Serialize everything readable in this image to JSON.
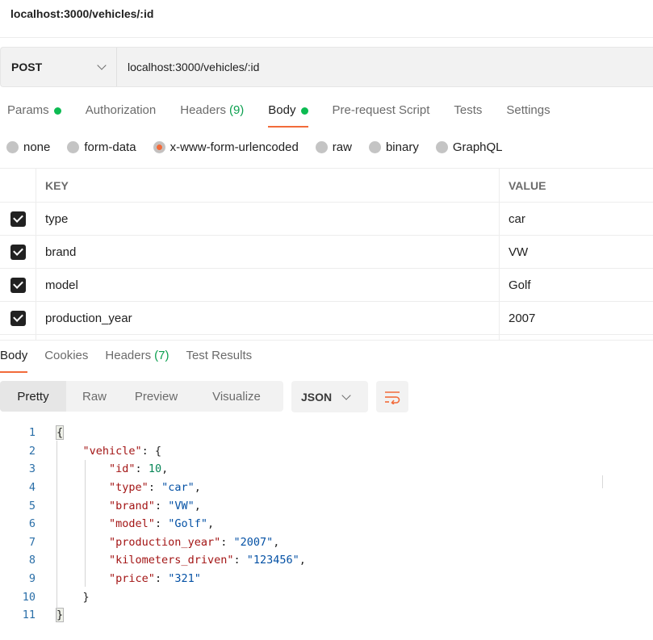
{
  "request": {
    "title": "localhost:3000/vehicles/:id",
    "method": "POST",
    "url": "localhost:3000/vehicles/:id"
  },
  "request_tabs": [
    {
      "label": "Params",
      "dot": true
    },
    {
      "label": "Authorization"
    },
    {
      "label": "Headers",
      "count": "(9)"
    },
    {
      "label": "Body",
      "dot": true,
      "active": true
    },
    {
      "label": "Pre-request Script"
    },
    {
      "label": "Tests"
    },
    {
      "label": "Settings"
    }
  ],
  "body_types": [
    {
      "label": "none"
    },
    {
      "label": "form-data"
    },
    {
      "label": "x-www-form-urlencoded",
      "selected": true
    },
    {
      "label": "raw"
    },
    {
      "label": "binary"
    },
    {
      "label": "GraphQL"
    }
  ],
  "kv_table": {
    "headers": {
      "key": "KEY",
      "value": "VALUE"
    },
    "rows": [
      {
        "key": "type",
        "value": "car",
        "checked": true
      },
      {
        "key": "brand",
        "value": "VW",
        "checked": true
      },
      {
        "key": "model",
        "value": "Golf",
        "checked": true
      },
      {
        "key": "production_year",
        "value": "2007",
        "checked": true
      }
    ]
  },
  "response_tabs": [
    {
      "label": "Body",
      "active": true
    },
    {
      "label": "Cookies"
    },
    {
      "label": "Headers",
      "count": "(7)"
    },
    {
      "label": "Test Results"
    }
  ],
  "view_modes": [
    "Pretty",
    "Raw",
    "Preview",
    "Visualize"
  ],
  "active_view_mode": "Pretty",
  "language": "JSON",
  "icons": {
    "wrap": "wrap-lines-icon",
    "method_dropdown": "chevron-down-icon"
  },
  "colors": {
    "accent": "#f26b3a",
    "dot": "#0cbb52",
    "count": "#0c9f4f",
    "json_key": "#a31515",
    "json_string": "#0451a5",
    "json_number": "#098658"
  },
  "response_lines": [
    {
      "n": "1",
      "parts": [
        {
          "t": "{",
          "c": "brace-root"
        }
      ]
    },
    {
      "n": "2",
      "parts": [
        {
          "t": "    "
        },
        {
          "t": "\"vehicle\"",
          "c": "k"
        },
        {
          "t": ": {"
        }
      ]
    },
    {
      "n": "3",
      "parts": [
        {
          "t": "        "
        },
        {
          "t": "\"id\"",
          "c": "k"
        },
        {
          "t": ": "
        },
        {
          "t": "10",
          "c": "n"
        },
        {
          "t": ","
        }
      ]
    },
    {
      "n": "4",
      "parts": [
        {
          "t": "        "
        },
        {
          "t": "\"type\"",
          "c": "k"
        },
        {
          "t": ": "
        },
        {
          "t": "\"car\"",
          "c": "s"
        },
        {
          "t": ","
        }
      ]
    },
    {
      "n": "5",
      "parts": [
        {
          "t": "        "
        },
        {
          "t": "\"brand\"",
          "c": "k"
        },
        {
          "t": ": "
        },
        {
          "t": "\"VW\"",
          "c": "s"
        },
        {
          "t": ","
        }
      ]
    },
    {
      "n": "6",
      "parts": [
        {
          "t": "        "
        },
        {
          "t": "\"model\"",
          "c": "k"
        },
        {
          "t": ": "
        },
        {
          "t": "\"Golf\"",
          "c": "s"
        },
        {
          "t": ","
        }
      ]
    },
    {
      "n": "7",
      "parts": [
        {
          "t": "        "
        },
        {
          "t": "\"production_year\"",
          "c": "k"
        },
        {
          "t": ": "
        },
        {
          "t": "\"2007\"",
          "c": "s"
        },
        {
          "t": ","
        }
      ]
    },
    {
      "n": "8",
      "parts": [
        {
          "t": "        "
        },
        {
          "t": "\"kilometers_driven\"",
          "c": "k"
        },
        {
          "t": ": "
        },
        {
          "t": "\"123456\"",
          "c": "s"
        },
        {
          "t": ","
        }
      ]
    },
    {
      "n": "9",
      "parts": [
        {
          "t": "        "
        },
        {
          "t": "\"price\"",
          "c": "k"
        },
        {
          "t": ": "
        },
        {
          "t": "\"321\"",
          "c": "s"
        }
      ]
    },
    {
      "n": "10",
      "parts": [
        {
          "t": "    }"
        }
      ]
    },
    {
      "n": "11",
      "parts": [
        {
          "t": "}",
          "c": "brace-root"
        }
      ]
    }
  ]
}
